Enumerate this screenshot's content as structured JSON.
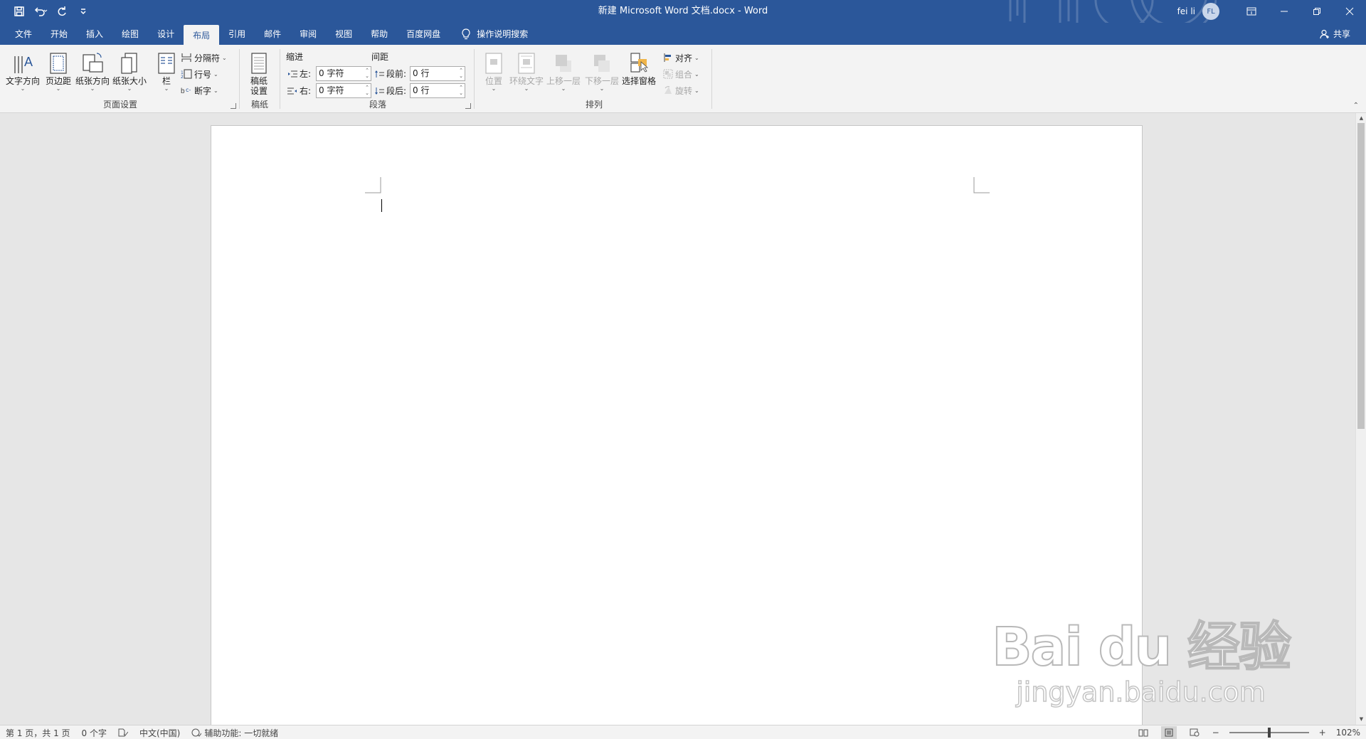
{
  "window": {
    "title": "新建 Microsoft Word 文档.docx  -  Word",
    "user_name": "fei li",
    "user_initials": "FL",
    "accent_color": "#2b579a"
  },
  "qat": {
    "save_icon": "save-icon",
    "undo_icon": "undo-icon",
    "redo_icon": "redo-icon",
    "customize_icon": "customize-qat-icon"
  },
  "tabs": [
    {
      "label": "文件",
      "active": false
    },
    {
      "label": "开始",
      "active": false
    },
    {
      "label": "插入",
      "active": false
    },
    {
      "label": "绘图",
      "active": false
    },
    {
      "label": "设计",
      "active": false
    },
    {
      "label": "布局",
      "active": true
    },
    {
      "label": "引用",
      "active": false
    },
    {
      "label": "邮件",
      "active": false
    },
    {
      "label": "审阅",
      "active": false
    },
    {
      "label": "视图",
      "active": false
    },
    {
      "label": "帮助",
      "active": false
    },
    {
      "label": "百度网盘",
      "active": false
    }
  ],
  "tell_me": "操作说明搜索",
  "share": "共享",
  "ribbon": {
    "page_setup": {
      "label": "页面设置",
      "text_direction": "文字方向",
      "margins": "页边距",
      "orientation": "纸张方向",
      "size": "纸张大小",
      "columns": "栏",
      "breaks": "分隔符",
      "line_numbers": "行号",
      "hyphenation": "断字"
    },
    "manuscript": {
      "label": "稿纸",
      "settings_line1": "稿纸",
      "settings_line2": "设置"
    },
    "paragraph": {
      "label": "段落",
      "indent_heading": "缩进",
      "spacing_heading": "间距",
      "left_label": "左:",
      "right_label": "右:",
      "before_label": "段前:",
      "after_label": "段后:",
      "left_value": "0 字符",
      "right_value": "0 字符",
      "before_value": "0 行",
      "after_value": "0 行"
    },
    "arrange": {
      "label": "排列",
      "position": "位置",
      "wrap_text": "环绕文字",
      "bring_forward": "上移一层",
      "send_backward": "下移一层",
      "selection_pane": "选择窗格",
      "align": "对齐",
      "group": "组合",
      "rotate": "旋转"
    }
  },
  "watermark": {
    "logo": "Bai du 经验",
    "url": "jingyan.baidu.com"
  },
  "status": {
    "page": "第 1 页，共 1 页",
    "words": "0 个字",
    "language": "中文(中国)",
    "accessibility": "辅助功能: 一切就绪",
    "zoom_minus": "−",
    "zoom_plus": "+",
    "zoom": "102%",
    "zoom_percent": 102
  }
}
